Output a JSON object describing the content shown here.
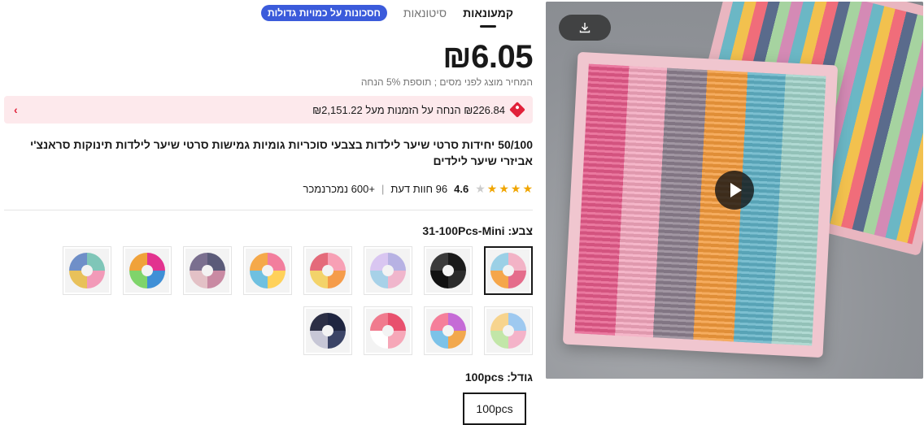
{
  "tabs": [
    {
      "label": "קמעונאות",
      "active": true
    },
    {
      "label": "סיטונאות",
      "active": false
    }
  ],
  "bulk_badge": "חסכונות על כמויות גדולות",
  "price": "₪6.05",
  "price_note": "המחיר מוצג לפני מסים ; תוספת 5% הנחה",
  "promo": {
    "text": "₪226.84 הנחה על הזמנות מעל ₪2,151.22",
    "tag_icon": "tag-icon",
    "chevron_icon": "chevron-right-icon"
  },
  "title": "50/100 יחידות סרטי שיער לילדות בצבעי סוכריות גומיות גמישות סרטי שיער לילדות תינוקות סראנצ'י אביזרי שיער לילדים",
  "rating": {
    "score": "4.6",
    "reviews": "96 חוות דעת",
    "sold": "+600 נמכרנמכר",
    "stars": 4.6
  },
  "color": {
    "label": "צבע: 31-100Pcs-Mini",
    "swatches": [
      {
        "colors": [
          "#f2b3c6",
          "#e56c8b",
          "#f5a64a",
          "#9bd0e6"
        ],
        "selected": true
      },
      {
        "colors": [
          "#1a1a1a",
          "#2b2b2b",
          "#111111",
          "#3a3a3a"
        ],
        "selected": false
      },
      {
        "colors": [
          "#b7b2e3",
          "#f0b6cc",
          "#a7d1e8",
          "#d9c6f1"
        ],
        "selected": false
      },
      {
        "colors": [
          "#f7a0b5",
          "#f59c4a",
          "#f3d36a",
          "#e46a7a"
        ],
        "selected": false
      },
      {
        "colors": [
          "#f27e9d",
          "#ffd15a",
          "#6fc0e0",
          "#f5a94a"
        ],
        "selected": false
      },
      {
        "colors": [
          "#5b5b79",
          "#c98aa3",
          "#e3c1c6",
          "#7a6f8f"
        ],
        "selected": false
      },
      {
        "colors": [
          "#e2338f",
          "#3f8fd6",
          "#7fd46b",
          "#f0a23a"
        ],
        "selected": false
      },
      {
        "colors": [
          "#7fc6b8",
          "#f29ab8",
          "#e8c15a",
          "#6f8fc8"
        ],
        "selected": false
      },
      {
        "colors": [
          "#9ec9f0",
          "#f4b3c9",
          "#c2e6a8",
          "#f7d48e"
        ],
        "selected": false
      },
      {
        "colors": [
          "#c56bd6",
          "#f2a84d",
          "#7cc2e8",
          "#f57f9a"
        ],
        "selected": false
      },
      {
        "colors": [
          "#e8506d",
          "#f6a7b8",
          "#ffffff",
          "#f07b8e"
        ],
        "selected": false
      },
      {
        "colors": [
          "#1f2540",
          "#3b4466",
          "#c7c7d6",
          "#2c2f45"
        ],
        "selected": false
      }
    ]
  },
  "size": {
    "label": "גודל: 100pcs",
    "options": [
      "100pcs"
    ]
  },
  "icons": {
    "download": "download-icon",
    "play": "play-icon"
  }
}
